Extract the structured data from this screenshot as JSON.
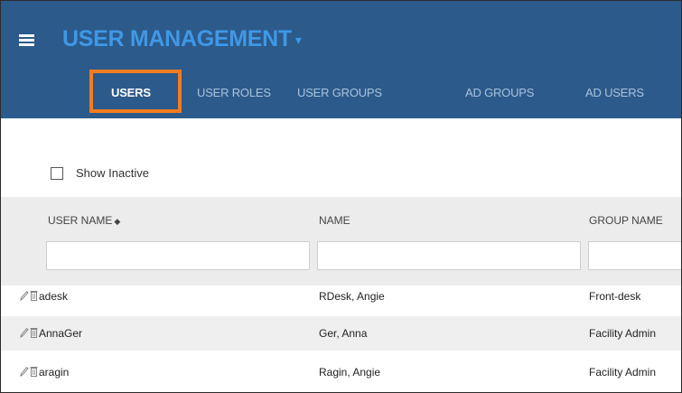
{
  "header": {
    "app_title": "USER MANAGEMENT",
    "title_caret": "▾",
    "tabs": [
      {
        "label": "USERS",
        "active": true
      },
      {
        "label": "USER ROLES",
        "active": false
      },
      {
        "label": "USER GROUPS",
        "active": false
      },
      {
        "label": "AD GROUPS",
        "active": false
      },
      {
        "label": "AD USERS",
        "active": false
      }
    ]
  },
  "filters": {
    "show_inactive_label": "Show Inactive",
    "show_inactive_checked": false
  },
  "grid": {
    "columns": [
      {
        "label": "USER NAME",
        "sortable": true
      },
      {
        "label": "NAME",
        "sortable": false
      },
      {
        "label": "GROUP NAME",
        "sortable": false
      }
    ],
    "sort_glyph": "◆",
    "filter_values": [
      "",
      "",
      ""
    ],
    "rows": [
      {
        "user_name": "adesk",
        "name": "RDesk, Angie",
        "group_name": "Front-desk"
      },
      {
        "user_name": "AnnaGer",
        "name": "Ger, Anna",
        "group_name": "Facility Admin"
      },
      {
        "user_name": "aragin",
        "name": "Ragin, Angie",
        "group_name": "Facility Admin"
      }
    ]
  },
  "icons": {
    "menu": "hamburger-menu-icon",
    "edit": "pencil-icon",
    "delete": "trash-icon",
    "sort": "sort-icon"
  },
  "colors": {
    "header_bg": "#2c5a8a",
    "accent": "#3f98e6",
    "highlight": "#f47c20",
    "inactive_tab": "#a9c3de"
  }
}
